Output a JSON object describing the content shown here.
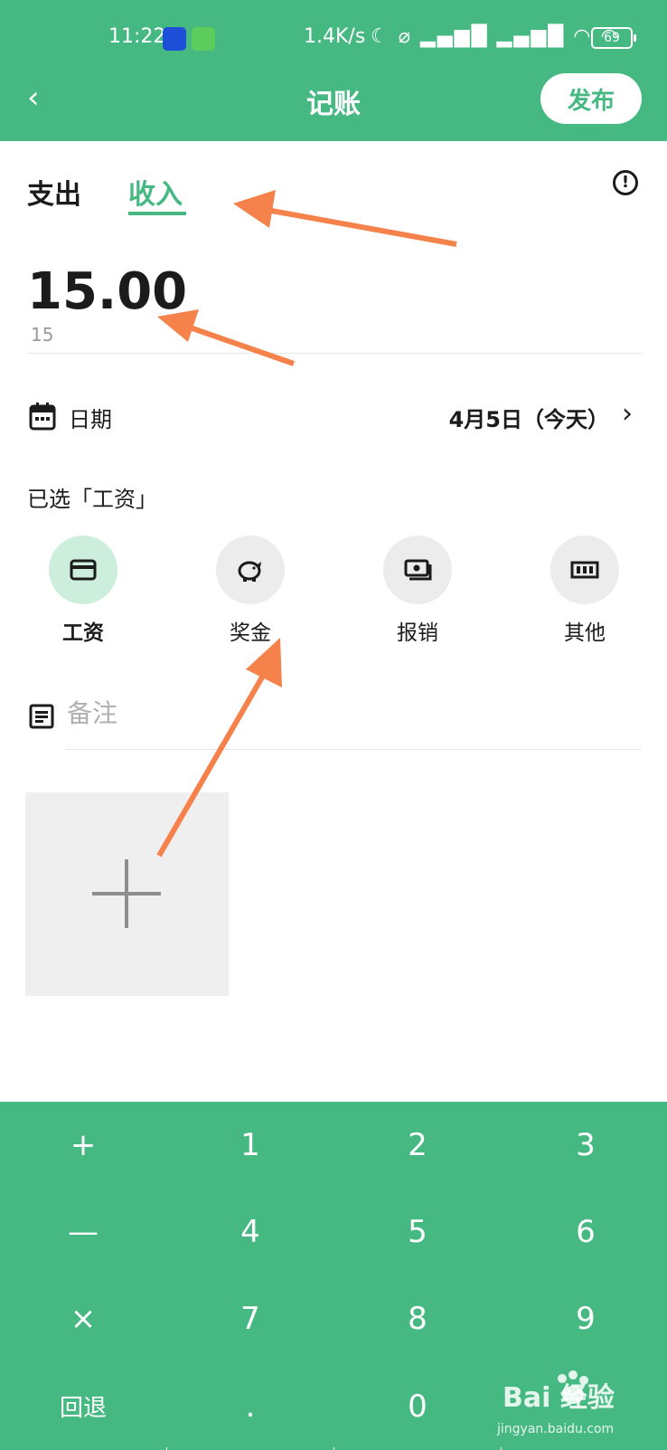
{
  "status_bar": {
    "time": "11:22",
    "network_speed": "1.4K/s",
    "battery": "69"
  },
  "nav": {
    "title": "记账",
    "publish_label": "发布"
  },
  "tabs": {
    "expense": "支出",
    "income": "收入",
    "active": "income"
  },
  "amount": {
    "value": "15.00",
    "raw": "15"
  },
  "date": {
    "label": "日期",
    "value": "4月5日（今天）"
  },
  "category": {
    "selected_text": "已选「工资」",
    "items": [
      {
        "label": "工资",
        "icon": "card-icon",
        "selected": true
      },
      {
        "label": "奖金",
        "icon": "piggy-bank-icon",
        "selected": false
      },
      {
        "label": "报销",
        "icon": "cash-icon",
        "selected": false
      },
      {
        "label": "其他",
        "icon": "other-icon",
        "selected": false
      }
    ]
  },
  "note": {
    "placeholder": "备注"
  },
  "keypad": {
    "rows": [
      [
        "+",
        "1",
        "2",
        "3"
      ],
      [
        "—",
        "4",
        "5",
        "6"
      ],
      [
        "×",
        "7",
        "8",
        "9"
      ],
      [
        "回退",
        ".",
        "0",
        ""
      ]
    ]
  },
  "watermark": {
    "brand": "Bai 经验",
    "site": "jingyan.baidu.com"
  },
  "colors": {
    "primary": "#46b983",
    "selected_bg": "#cdeedc",
    "arrow": "#f5824b"
  }
}
